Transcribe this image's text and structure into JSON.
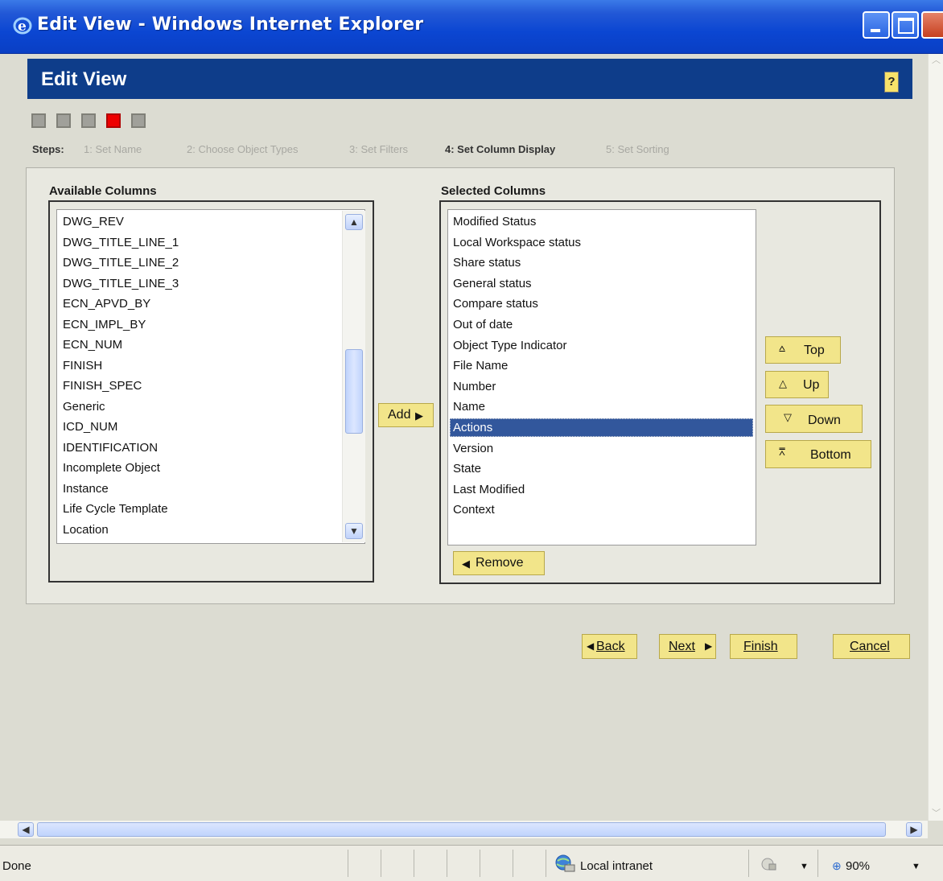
{
  "window": {
    "title": "Edit View - Windows Internet Explorer"
  },
  "header": {
    "title": "Edit View",
    "help_label": "?"
  },
  "steps": {
    "label": "Steps:",
    "items": [
      "1: Set Name",
      "2: Choose Object Types",
      "3: Set Filters",
      "4: Set Column Display",
      "5: Set Sorting"
    ],
    "current": 4
  },
  "available": {
    "title": "Available Columns",
    "items": [
      "DWG_REV",
      "DWG_TITLE_LINE_1",
      "DWG_TITLE_LINE_2",
      "DWG_TITLE_LINE_3",
      "ECN_APVD_BY",
      "ECN_IMPL_BY",
      "ECN_NUM",
      "FINISH",
      "FINISH_SPEC",
      "Generic",
      "ICD_NUM",
      "IDENTIFICATION",
      "Incomplete Object",
      "Instance",
      "Life Cycle Template",
      "Location"
    ]
  },
  "selected": {
    "title": "Selected Columns",
    "items": [
      "Modified Status",
      "Local Workspace status",
      "Share status",
      "General status",
      "Compare status",
      "Out of date",
      "Object Type Indicator",
      "File Name",
      "Number",
      "Name",
      "Actions",
      "Version",
      "State",
      "Last Modified",
      "Context"
    ],
    "selected_item": "Actions"
  },
  "buttons": {
    "add": "Add",
    "remove": "Remove",
    "top": "Top",
    "up": "Up",
    "down": "Down",
    "bottom": "Bottom",
    "back": "Back",
    "next": "Next",
    "finish": "Finish",
    "cancel": "Cancel"
  },
  "statusbar": {
    "status": "Done",
    "zone": "Local intranet",
    "zoom": "90%"
  },
  "colors": {
    "header": "#0e3d8a",
    "button": "#f2e58a",
    "current_step": "#ee0000",
    "selection": "#32579c"
  }
}
